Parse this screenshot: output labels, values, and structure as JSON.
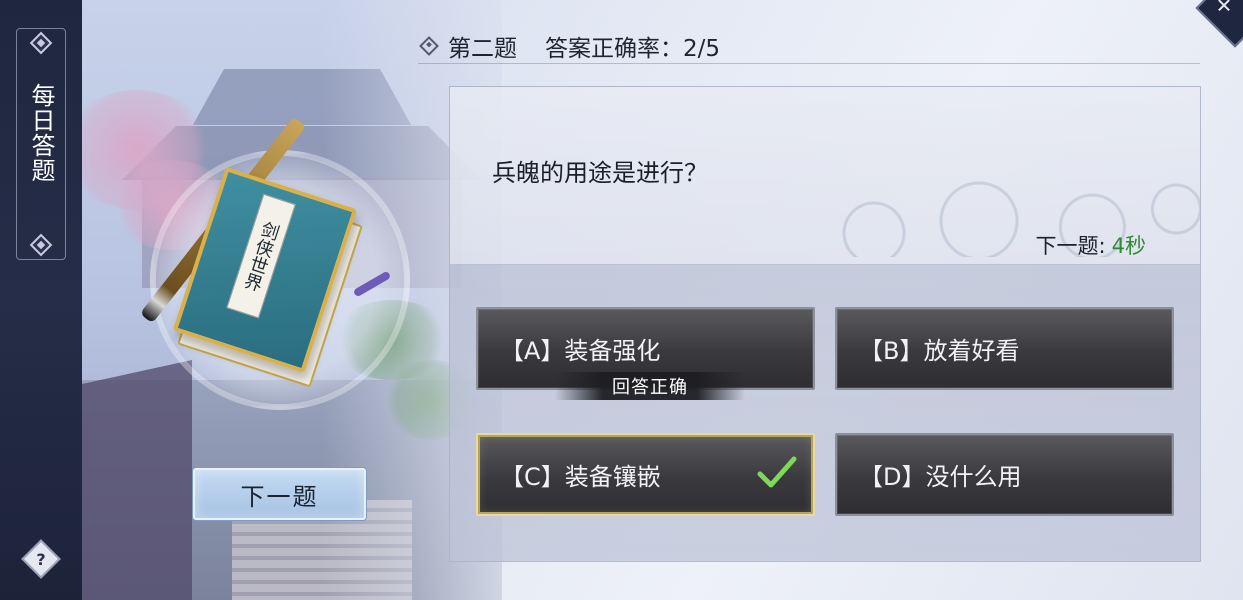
{
  "sidebar": {
    "title": "每日答题",
    "help_symbol": "?"
  },
  "illustration": {
    "book_title": "剑侠世界"
  },
  "header": {
    "question_number": "第二题",
    "accuracy": "答案正确率：2/5"
  },
  "close_symbol": "✕",
  "question": {
    "text": "兵魄的用途是进行？",
    "countdown_label": "下一题:",
    "countdown_value": "4秒"
  },
  "options": [
    {
      "key": "A",
      "label": "【A】装备强化",
      "state": "normal"
    },
    {
      "key": "B",
      "label": "【B】放着好看",
      "state": "normal"
    },
    {
      "key": "C",
      "label": "【C】装备镶嵌",
      "state": "selected-correct"
    },
    {
      "key": "D",
      "label": "【D】没什么用",
      "state": "normal"
    }
  ],
  "feedback": {
    "correct_text": "回答正确"
  },
  "next_button": {
    "label": "下一题"
  },
  "colors": {
    "sidebar_bg": "#1f2740",
    "countdown_accent": "#2e8a2e",
    "selected_border": "#e8d9a0",
    "check_color": "#7ed957"
  }
}
